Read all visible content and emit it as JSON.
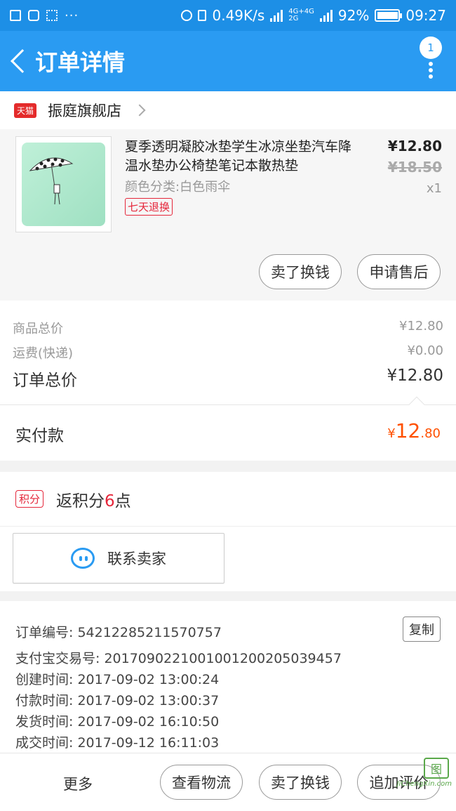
{
  "status_bar": {
    "speed": "0.49K/s",
    "battery": "92%",
    "time": "09:27",
    "icons": [
      "image-icon",
      "package-icon",
      "apps-icon",
      "more-dots-icon",
      "location-icon",
      "vibrate-icon",
      "signal-icon",
      "battery-icon"
    ]
  },
  "header": {
    "title": "订单详情",
    "badge_count": "1"
  },
  "shop": {
    "tag": "天猫",
    "name": "振庭旗舰店"
  },
  "product": {
    "title": "夏季透明凝胶冰垫学生冰凉坐垫汽车降温水垫办公椅垫笔记本散热垫",
    "attribute": "颜色分类:白色雨伞",
    "tag": "七天退换",
    "price": "¥12.80",
    "original_price": "¥18.50",
    "quantity": "x1",
    "buttons": {
      "sell": "卖了换钱",
      "after_sale": "申请售后"
    }
  },
  "summary": {
    "goods_label": "商品总价",
    "goods_value": "¥12.80",
    "shipping_label": "运费(快递)",
    "shipping_value": "¥0.00",
    "total_label": "订单总价",
    "total_value": "¥12.80",
    "paid_label": "实付款",
    "paid_currency": "¥",
    "paid_int": "12",
    "paid_dec": ".80"
  },
  "points": {
    "tag": "积分",
    "text_prefix": "返积分",
    "value": "6",
    "text_suffix": "点"
  },
  "contact": {
    "label": "联系卖家"
  },
  "order_info": {
    "copy_label": "复制",
    "lines": [
      "订单编号: 54212285211570757",
      "支付宝交易号: 2017090221001001200205039457",
      "创建时间: 2017-09-02 13:00:24",
      "付款时间: 2017-09-02 13:00:37",
      "发货时间: 2017-09-02 16:10:50",
      "成交时间: 2017-09-12 16:11:03"
    ]
  },
  "bottom_bar": {
    "more": "更多",
    "logistics": "查看物流",
    "sell": "卖了换钱",
    "review": "追加评价",
    "watermark": "JiChengXin.com"
  },
  "colors": {
    "primary": "#2a9bf2",
    "status_bar": "#1d8fe6",
    "accent_red": "#e5263a",
    "paid_orange": "#ff5000"
  }
}
